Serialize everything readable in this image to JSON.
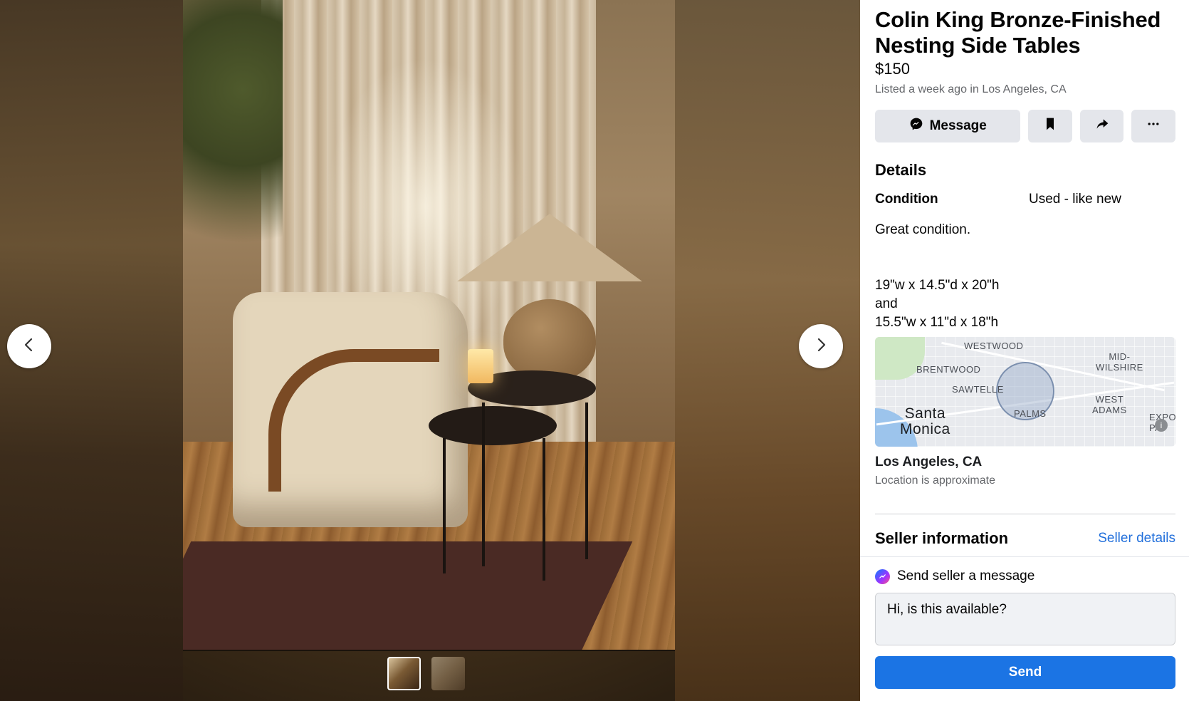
{
  "listing": {
    "title": "Colin King Bronze-Finished Nesting Side Tables",
    "price": "$150",
    "listed": "Listed a week ago in Los Angeles, CA"
  },
  "actions": {
    "message_label": "Message",
    "save_icon": "bookmark-icon",
    "share_icon": "share-icon",
    "more_icon": "more-icon"
  },
  "details": {
    "heading": "Details",
    "condition_label": "Condition",
    "condition_value": "Used - like new",
    "description": "Great condition.\n\n\n19\"w x 14.5\"d x 20\"h\nand\n15.5\"w x 11\"d x 18\"h"
  },
  "map": {
    "labels": {
      "westwood": "WESTWOOD",
      "mid_wilshire": "MID-\nWILSHIRE",
      "brentwood": "BRENTWOOD",
      "sawtelle": "SAWTELLE",
      "west_adams": "WEST\nADAMS",
      "santa_monica": "Santa\nMonica",
      "palms": "PALMS",
      "expo": "EXPO\nPA"
    },
    "info": "i"
  },
  "location": {
    "city": "Los Angeles, CA",
    "note": "Location is approximate"
  },
  "seller": {
    "heading": "Seller information",
    "details_link": "Seller details"
  },
  "contact": {
    "prompt": "Send seller a message",
    "message_value": "Hi, is this available?",
    "send_label": "Send"
  },
  "colors": {
    "accent": "#1b74e4",
    "link": "#216fdb",
    "muted": "#65676b"
  }
}
